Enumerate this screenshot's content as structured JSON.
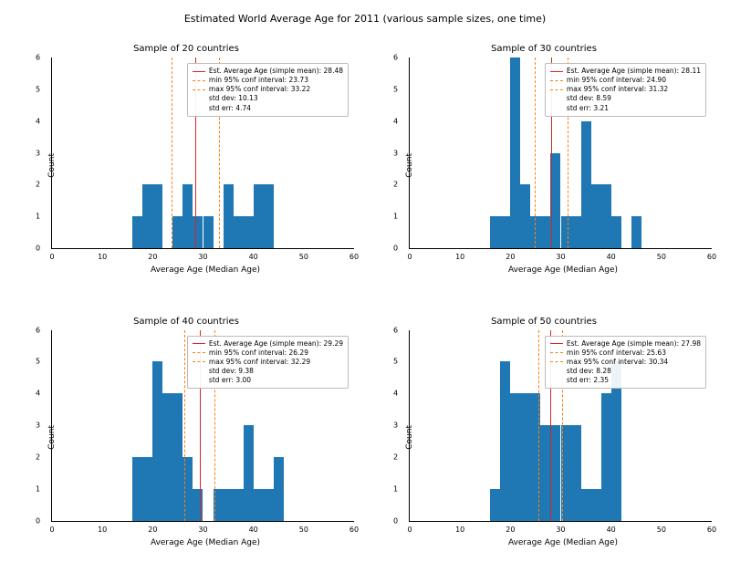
{
  "figure_title": "Estimated World Average Age for 2011 (various sample sizes, one time)",
  "panels": [
    {
      "title": "Sample of 20 countries",
      "xlabel": "Average Age (Median Age)",
      "ylabel": "Count",
      "xlim": [
        0,
        60
      ],
      "ylim": [
        0,
        6
      ],
      "xticks": [
        0,
        10,
        20,
        30,
        40,
        50,
        60
      ],
      "yticks": [
        0,
        1,
        2,
        3,
        4,
        5,
        6
      ],
      "mean": 28.48,
      "ci_min": 23.73,
      "ci_max": 33.22,
      "std_dev": 10.13,
      "std_err": 4.74,
      "bin_width": 2,
      "bars": [
        {
          "x": 16,
          "y": 1
        },
        {
          "x": 18,
          "y": 2
        },
        {
          "x": 20,
          "y": 2
        },
        {
          "x": 24,
          "y": 1
        },
        {
          "x": 26,
          "y": 2
        },
        {
          "x": 28,
          "y": 1
        },
        {
          "x": 30,
          "y": 1
        },
        {
          "x": 34,
          "y": 2
        },
        {
          "x": 36,
          "y": 1
        },
        {
          "x": 38,
          "y": 1
        },
        {
          "x": 40,
          "y": 2
        },
        {
          "x": 42,
          "y": 2
        }
      ],
      "legend_lines": [
        {
          "swatch": "mean",
          "text": "Est. Average Age (simple mean): 28.48"
        },
        {
          "swatch": "ci",
          "text": "min 95% conf interval: 23.73"
        },
        {
          "swatch": "ci",
          "text": "max 95% conf interval: 33.22"
        },
        {
          "swatch": "none",
          "text": "std dev: 10.13"
        },
        {
          "swatch": "none",
          "text": "std err: 4.74"
        }
      ]
    },
    {
      "title": "Sample of 30 countries",
      "xlabel": "Average Age (Median Age)",
      "ylabel": "Count",
      "xlim": [
        0,
        60
      ],
      "ylim": [
        0,
        6
      ],
      "xticks": [
        0,
        10,
        20,
        30,
        40,
        50,
        60
      ],
      "yticks": [
        0,
        1,
        2,
        3,
        4,
        5,
        6
      ],
      "mean": 28.11,
      "ci_min": 24.9,
      "ci_max": 31.32,
      "std_dev": 8.59,
      "std_err": 3.21,
      "bin_width": 2,
      "bars": [
        {
          "x": 16,
          "y": 1
        },
        {
          "x": 18,
          "y": 1
        },
        {
          "x": 20,
          "y": 6
        },
        {
          "x": 22,
          "y": 2
        },
        {
          "x": 24,
          "y": 1
        },
        {
          "x": 26,
          "y": 1
        },
        {
          "x": 28,
          "y": 3
        },
        {
          "x": 30,
          "y": 1
        },
        {
          "x": 32,
          "y": 1
        },
        {
          "x": 34,
          "y": 4
        },
        {
          "x": 36,
          "y": 2
        },
        {
          "x": 38,
          "y": 2
        },
        {
          "x": 40,
          "y": 1
        },
        {
          "x": 44,
          "y": 1
        }
      ],
      "legend_lines": [
        {
          "swatch": "mean",
          "text": "Est. Average Age (simple mean): 28.11"
        },
        {
          "swatch": "ci",
          "text": "min 95% conf interval: 24.90"
        },
        {
          "swatch": "ci",
          "text": "max 95% conf interval: 31.32"
        },
        {
          "swatch": "none",
          "text": "std dev: 8.59"
        },
        {
          "swatch": "none",
          "text": "std err: 3.21"
        }
      ]
    },
    {
      "title": "Sample of 40 countries",
      "xlabel": "Average Age (Median Age)",
      "ylabel": "Count",
      "xlim": [
        0,
        60
      ],
      "ylim": [
        0,
        6
      ],
      "xticks": [
        0,
        10,
        20,
        30,
        40,
        50,
        60
      ],
      "yticks": [
        0,
        1,
        2,
        3,
        4,
        5,
        6
      ],
      "mean": 29.29,
      "ci_min": 26.29,
      "ci_max": 32.29,
      "std_dev": 9.38,
      "std_err": 3.0,
      "bin_width": 2,
      "bars": [
        {
          "x": 16,
          "y": 2
        },
        {
          "x": 18,
          "y": 2
        },
        {
          "x": 20,
          "y": 5
        },
        {
          "x": 22,
          "y": 4
        },
        {
          "x": 24,
          "y": 4
        },
        {
          "x": 26,
          "y": 2
        },
        {
          "x": 28,
          "y": 1
        },
        {
          "x": 32,
          "y": 1
        },
        {
          "x": 34,
          "y": 1
        },
        {
          "x": 36,
          "y": 1
        },
        {
          "x": 38,
          "y": 3
        },
        {
          "x": 40,
          "y": 1
        },
        {
          "x": 42,
          "y": 1
        },
        {
          "x": 44,
          "y": 2
        }
      ],
      "legend_lines": [
        {
          "swatch": "mean",
          "text": "Est. Average Age (simple mean): 29.29"
        },
        {
          "swatch": "ci",
          "text": "min 95% conf interval: 26.29"
        },
        {
          "swatch": "ci",
          "text": "max 95% conf interval: 32.29"
        },
        {
          "swatch": "none",
          "text": "std dev: 9.38"
        },
        {
          "swatch": "none",
          "text": "std err: 3.00"
        }
      ]
    },
    {
      "title": "Sample of 50 countries",
      "xlabel": "Average Age (Median Age)",
      "ylabel": "Count",
      "xlim": [
        0,
        60
      ],
      "ylim": [
        0,
        6
      ],
      "xticks": [
        0,
        10,
        20,
        30,
        40,
        50,
        60
      ],
      "yticks": [
        0,
        1,
        2,
        3,
        4,
        5,
        6
      ],
      "mean": 27.98,
      "ci_min": 25.63,
      "ci_max": 30.34,
      "std_dev": 8.28,
      "std_err": 2.35,
      "bin_width": 2,
      "bars": [
        {
          "x": 16,
          "y": 1
        },
        {
          "x": 18,
          "y": 5
        },
        {
          "x": 20,
          "y": 4
        },
        {
          "x": 22,
          "y": 4
        },
        {
          "x": 24,
          "y": 4
        },
        {
          "x": 26,
          "y": 3
        },
        {
          "x": 28,
          "y": 3
        },
        {
          "x": 30,
          "y": 3
        },
        {
          "x": 32,
          "y": 3
        },
        {
          "x": 34,
          "y": 1
        },
        {
          "x": 36,
          "y": 1
        },
        {
          "x": 38,
          "y": 4
        },
        {
          "x": 40,
          "y": 5
        }
      ],
      "legend_lines": [
        {
          "swatch": "mean",
          "text": "Est. Average Age (simple mean): 27.98"
        },
        {
          "swatch": "ci",
          "text": "min 95% conf interval: 25.63"
        },
        {
          "swatch": "ci",
          "text": "max 95% conf interval: 30.34"
        },
        {
          "swatch": "none",
          "text": "std dev: 8.28"
        },
        {
          "swatch": "none",
          "text": "std err: 2.35"
        }
      ]
    }
  ],
  "chart_data": [
    {
      "type": "bar",
      "title": "Sample of 20 countries",
      "xlabel": "Average Age (Median Age)",
      "ylabel": "Count",
      "xlim": [
        0,
        60
      ],
      "ylim": [
        0,
        6
      ],
      "bin_width": 2,
      "x": [
        16,
        18,
        20,
        24,
        26,
        28,
        30,
        34,
        36,
        38,
        40,
        42
      ],
      "values": [
        1,
        2,
        2,
        1,
        2,
        1,
        1,
        2,
        1,
        1,
        2,
        2
      ],
      "annotations": {
        "mean": 28.48,
        "ci95": [
          23.73,
          33.22
        ],
        "std_dev": 10.13,
        "std_err": 4.74
      }
    },
    {
      "type": "bar",
      "title": "Sample of 30 countries",
      "xlabel": "Average Age (Median Age)",
      "ylabel": "Count",
      "xlim": [
        0,
        60
      ],
      "ylim": [
        0,
        6
      ],
      "bin_width": 2,
      "x": [
        16,
        18,
        20,
        22,
        24,
        26,
        28,
        30,
        32,
        34,
        36,
        38,
        40,
        44
      ],
      "values": [
        1,
        1,
        6,
        2,
        1,
        1,
        3,
        1,
        1,
        4,
        2,
        2,
        1,
        1
      ],
      "annotations": {
        "mean": 28.11,
        "ci95": [
          24.9,
          31.32
        ],
        "std_dev": 8.59,
        "std_err": 3.21
      }
    },
    {
      "type": "bar",
      "title": "Sample of 40 countries",
      "xlabel": "Average Age (Median Age)",
      "ylabel": "Count",
      "xlim": [
        0,
        60
      ],
      "ylim": [
        0,
        6
      ],
      "bin_width": 2,
      "x": [
        16,
        18,
        20,
        22,
        24,
        26,
        28,
        32,
        34,
        36,
        38,
        40,
        42,
        44
      ],
      "values": [
        2,
        2,
        5,
        4,
        4,
        2,
        1,
        1,
        1,
        1,
        3,
        1,
        1,
        2
      ],
      "annotations": {
        "mean": 29.29,
        "ci95": [
          26.29,
          32.29
        ],
        "std_dev": 9.38,
        "std_err": 3.0
      }
    },
    {
      "type": "bar",
      "title": "Sample of 50 countries",
      "xlabel": "Average Age (Median Age)",
      "ylabel": "Count",
      "xlim": [
        0,
        60
      ],
      "ylim": [
        0,
        6
      ],
      "bin_width": 2,
      "x": [
        16,
        18,
        20,
        22,
        24,
        26,
        28,
        30,
        32,
        34,
        36,
        38,
        40
      ],
      "values": [
        1,
        5,
        4,
        4,
        4,
        3,
        3,
        3,
        3,
        1,
        1,
        4,
        5
      ],
      "annotations": {
        "mean": 27.98,
        "ci95": [
          25.63,
          30.34
        ],
        "std_dev": 8.28,
        "std_err": 2.35
      }
    }
  ]
}
